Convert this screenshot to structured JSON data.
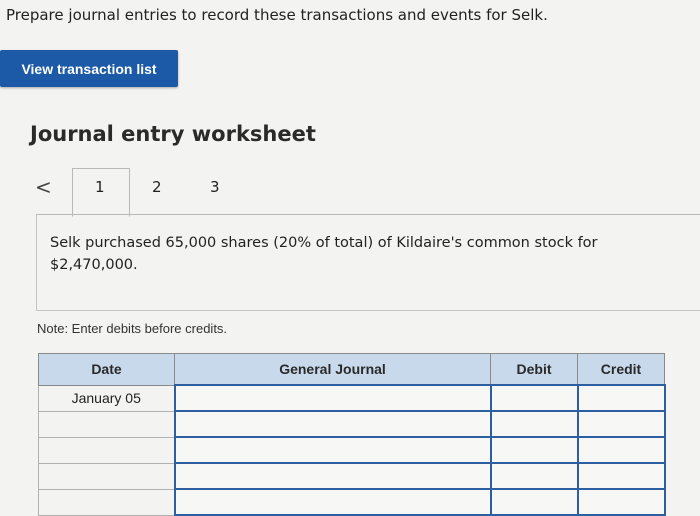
{
  "instruction": "Prepare journal entries to record these transactions and events for Selk.",
  "view_button": "View transaction list",
  "worksheet_title": "Journal entry worksheet",
  "nav": {
    "prev_symbol": "<",
    "tabs": [
      "1",
      "2",
      "3"
    ],
    "active_tab": "1"
  },
  "description_line1": "Selk purchased 65,000 shares (20% of total) of Kildaire's common stock for",
  "description_line2": "$2,470,000.",
  "note": "Note: Enter debits before credits.",
  "table": {
    "headers": [
      "Date",
      "General Journal",
      "Debit",
      "Credit"
    ],
    "rows": [
      {
        "date": "January 05",
        "account": "",
        "debit": "",
        "credit": ""
      },
      {
        "date": "",
        "account": "",
        "debit": "",
        "credit": ""
      },
      {
        "date": "",
        "account": "",
        "debit": "",
        "credit": ""
      },
      {
        "date": "",
        "account": "",
        "debit": "",
        "credit": ""
      },
      {
        "date": "",
        "account": "",
        "debit": "",
        "credit": ""
      }
    ]
  },
  "colors": {
    "button_bg": "#1c5aa8",
    "header_bg": "#c9d9ec",
    "input_border": "#2c5ea0"
  }
}
